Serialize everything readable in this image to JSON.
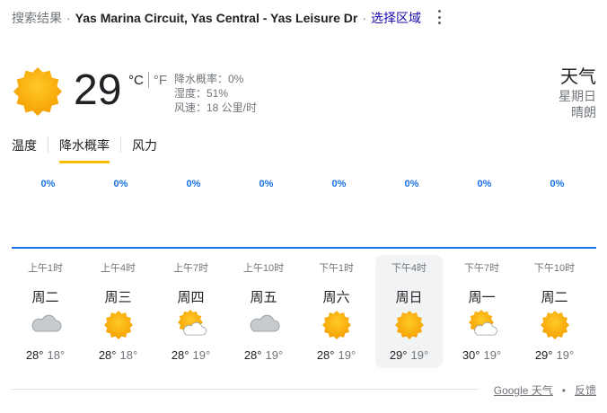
{
  "header": {
    "prefix": "搜索结果",
    "location": "Yas Marina Circuit, Yas Central - Yas Leisure Dr",
    "change_region": "选择区域"
  },
  "current": {
    "icon": "sunny",
    "temperature": "29",
    "unit_c": "°C",
    "unit_f": "°F",
    "active_unit": "C",
    "precipitation": "降水概率：0%",
    "humidity": "湿度：51%",
    "wind": "风速：18 公里/时",
    "title": "天气",
    "day": "星期日",
    "condition": "晴朗"
  },
  "tabs": [
    {
      "label": "温度",
      "active": false
    },
    {
      "label": "降水概率",
      "active": true
    },
    {
      "label": "风力",
      "active": false
    }
  ],
  "precip_chart": {
    "values": [
      "0%",
      "0%",
      "0%",
      "0%",
      "0%",
      "0%",
      "0%",
      "0%"
    ],
    "color": "#1a73e8"
  },
  "forecast": [
    {
      "time": "上午1时",
      "day": "周二",
      "icon": "cloudy",
      "high": "28°",
      "low": "18°",
      "selected": false
    },
    {
      "time": "上午4时",
      "day": "周三",
      "icon": "sunny",
      "high": "28°",
      "low": "18°",
      "selected": false
    },
    {
      "time": "上午7时",
      "day": "周四",
      "icon": "partly-cloudy",
      "high": "28°",
      "low": "19°",
      "selected": false
    },
    {
      "time": "上午10时",
      "day": "周五",
      "icon": "cloudy",
      "high": "28°",
      "low": "19°",
      "selected": false
    },
    {
      "time": "下午1时",
      "day": "周六",
      "icon": "sunny",
      "high": "28°",
      "low": "19°",
      "selected": false
    },
    {
      "time": "下午4时",
      "day": "周日",
      "icon": "sunny",
      "high": "29°",
      "low": "19°",
      "selected": true
    },
    {
      "time": "下午7时",
      "day": "周一",
      "icon": "partly-cloudy",
      "high": "30°",
      "low": "19°",
      "selected": false
    },
    {
      "time": "下午10时",
      "day": "周二",
      "icon": "sunny",
      "high": "29°",
      "low": "19°",
      "selected": false
    }
  ],
  "footer": {
    "source": "Google 天气",
    "feedback": "反馈"
  },
  "colors": {
    "accent_tab": "#fbbc04",
    "sun": "#f9a825",
    "cloud": "#bdc1c6"
  }
}
